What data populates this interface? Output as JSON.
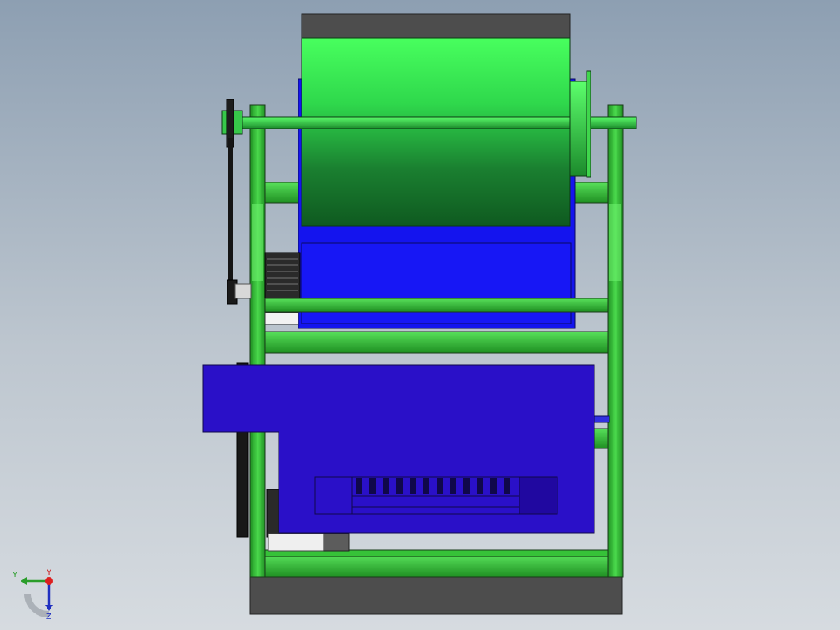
{
  "viewport": {
    "background_top": "#8d9fb2",
    "background_bottom": "#d6dbe0"
  },
  "colors": {
    "frame_green": "#2fae2f",
    "drum_green": "#3ff55a",
    "drum_dark": "#176d2a",
    "housing_blue": "#1414ee",
    "box_indigo": "#2a10c8",
    "base_gray": "#4d4d4d"
  },
  "triad": {
    "y_label": "Y",
    "x_label": "Y",
    "z_label": "Z",
    "y_color": "#2a9d2a",
    "x_color": "#cc2020",
    "z_color": "#2030c0"
  }
}
